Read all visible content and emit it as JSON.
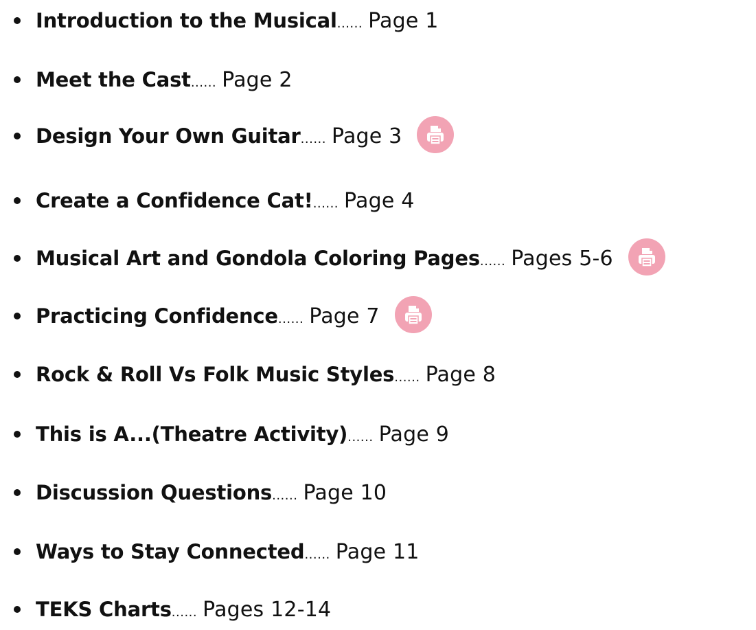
{
  "toc": {
    "items": [
      {
        "title": "Introduction to the Musical",
        "separator": "......",
        "pages": "Page 1",
        "print_icon": false
      },
      {
        "title": "Meet the Cast",
        "separator": "......",
        "pages": "Page 2",
        "print_icon": false
      },
      {
        "title": "Design Your Own Guitar",
        "separator": "......",
        "pages": "Page 3",
        "print_icon": true
      },
      {
        "title": "Create a Confidence Cat!",
        "separator": "......",
        "pages": "Page 4",
        "print_icon": false
      },
      {
        "title": "Musical Art and Gondola Coloring Pages",
        "separator": "......",
        "pages": "Pages 5-6",
        "print_icon": true
      },
      {
        "title": "Practicing Confidence",
        "separator": "......",
        "pages": "Page 7",
        "print_icon": true
      },
      {
        "title": "Rock & Roll Vs Folk Music Styles",
        "separator": "......",
        "pages": "Page 8",
        "print_icon": false
      },
      {
        "title": "This is A...(Theatre Activity)",
        "separator": "......",
        "pages": "Page 9",
        "print_icon": false
      },
      {
        "title": "Discussion Questions",
        "separator": "......",
        "pages": "Page 10",
        "print_icon": false
      },
      {
        "title": "Ways to Stay Connected",
        "separator": "......",
        "pages": "Page 11",
        "print_icon": false
      },
      {
        "title": "TEKS Charts",
        "separator": "......",
        "pages": "Pages 12-14",
        "print_icon": false
      }
    ],
    "icon_name": "printer-icon",
    "icon_color": "#f2a3b4",
    "text_color": "#111111"
  }
}
